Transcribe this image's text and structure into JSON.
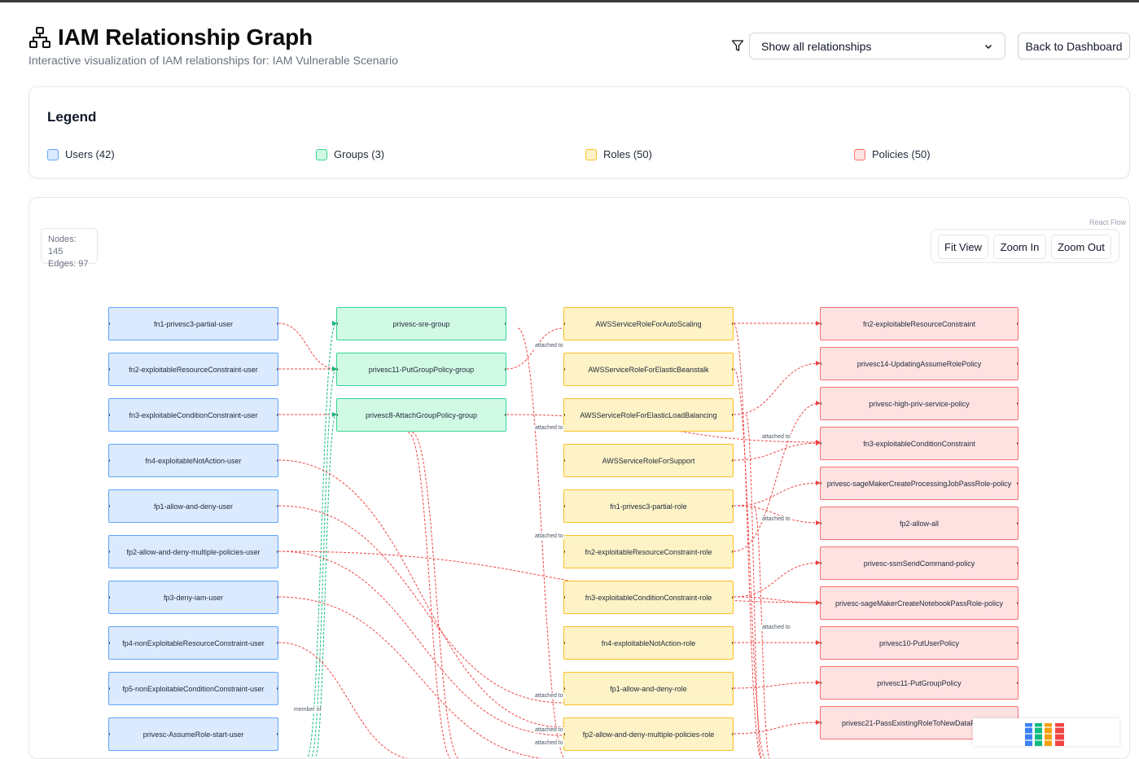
{
  "header": {
    "title": "IAM Relationship Graph",
    "subtitle": "Interactive visualization of IAM relationships for: IAM Vulnerable Scenario",
    "filter_value": "Show all relationships",
    "back_label": "Back to Dashboard"
  },
  "legend": {
    "title": "Legend",
    "items": [
      {
        "label": "Users (42)",
        "color": "#dbeafe",
        "border": "#60a5fa"
      },
      {
        "label": "Groups (3)",
        "color": "#d1fae5",
        "border": "#34d399"
      },
      {
        "label": "Roles (50)",
        "color": "#fef3c7",
        "border": "#fbbf24"
      },
      {
        "label": "Policies (50)",
        "color": "#fee2e2",
        "border": "#f87171"
      }
    ]
  },
  "graph": {
    "nodes_label": "Nodes: 145",
    "edges_label": "Edges: 97",
    "credit": "React Flow",
    "controls": {
      "fit": "Fit View",
      "zoom_in": "Zoom In",
      "zoom_out": "Zoom Out"
    },
    "users": [
      "fn1-privesc3-partial-user",
      "fn2-exploitableResourceConstraint-user",
      "fn3-exploitableConditionConstraint-user",
      "fn4-exploitableNotAction-user",
      "fp1-allow-and-deny-user",
      "fp2-allow-and-deny-multiple-policies-user",
      "fp3-deny-iam-user",
      "fp4-nonExploitableResourceConstraint-user",
      "fp5-nonExploitableConditionConstraint-user",
      "privesc-AssumeRole-start-user"
    ],
    "groups": [
      "privesc-sre-group",
      "privesc11-PutGroupPolicy-group",
      "privesc8-AttachGroupPolicy-group"
    ],
    "roles": [
      "AWSServiceRoleForAutoScaling",
      "AWSServiceRoleForElasticBeanstalk",
      "AWSServiceRoleForElasticLoadBalancing",
      "AWSServiceRoleForSupport",
      "fn1-privesc3-partial-role",
      "fn2-exploitableResourceConstraint-role",
      "fn3-exploitableConditionConstraint-role",
      "fn4-exploitableNotAction-role",
      "fp1-allow-and-deny-role",
      "fp2-allow-and-deny-multiple-policies-role"
    ],
    "policies": [
      "fn2-exploitableResourceConstraint",
      "privesc14-UpdatingAssumeRolePolicy",
      "privesc-high-priv-service-policy",
      "fn3-exploitableConditionConstraint",
      "privesc-sageMakerCreateProcessingJobPassRole-policy",
      "fp2-allow-all",
      "privesc-ssmSendCommand-policy",
      "privesc-sageMakerCreateNotebookPassRole-policy",
      "privesc10-PutUserPolicy",
      "privesc11-PutGroupPolicy",
      "privesc21-PassExistingRoleToNewDataPipeline"
    ],
    "edge_labels": {
      "attached": "attached to",
      "member": "member of"
    }
  }
}
